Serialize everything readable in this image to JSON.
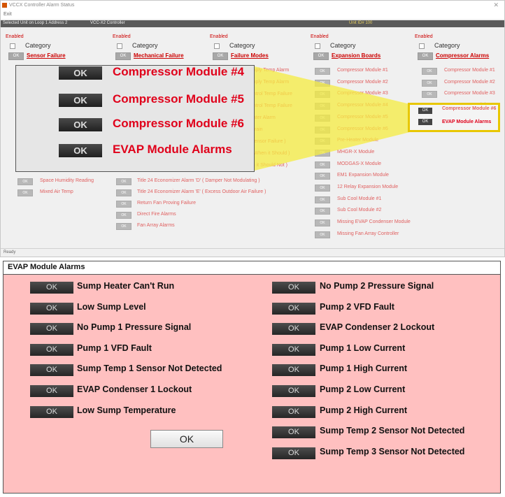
{
  "window": {
    "title": "VCCX Controller Alarm Status",
    "menu_exit": "Exit",
    "selected_unit": "Selected Unit on Loop 1 Address 2",
    "controller": "VCC-X2 Controller",
    "unit_id": "Unit ID# 100",
    "status": "Ready"
  },
  "headers": {
    "enabled": "Enabled",
    "category": "Category",
    "ok": "OK"
  },
  "categories": [
    {
      "name": "Sensor Failure"
    },
    {
      "name": "Mechanical Failure"
    },
    {
      "name": "Failure Modes"
    },
    {
      "name": "Expansion Boards"
    },
    {
      "name": "Compressor Alarms"
    }
  ],
  "col1_items": [
    "Space Humidity Reading",
    "Mixed Air Temp"
  ],
  "col2_items": [
    "Title 24 Economizer Alarm 'D'  ( Damper Not Modulating )",
    "Title 24 Economizer Alarm 'E'  ( Excess Outdoor Air Failure )",
    "Return Fan Proving Failure",
    "Direct Fire Alarms",
    "Fan Array Alarms"
  ],
  "col3_partial": [
    "Supply Temp Alarm",
    "Supply Temp Alarm",
    "Control Temp Failure",
    "Control Temp Failure",
    "Heater Alarm",
    "p Drain",
    "e Sensor Failure )",
    "ng When it Should )",
    "hen it Should Not )"
  ],
  "col4_items": [
    "Compressor Module #1",
    "Compressor Module #2",
    "Compressor Module #3",
    "Compressor Module #4",
    "Compressor Module #5",
    "Compressor Module #6",
    "Pre-Heater Module",
    "MHGR-X Module",
    "MODGAS-X Module",
    "EM1 Expansion Module",
    "12 Relay Expansion Module",
    "Sub Cool Module #1",
    "Sub Cool Module #2",
    "Missing EVAP Condenser Module",
    "Missing Fan Array Controller"
  ],
  "col5_items": [
    "Compressor Module #1",
    "Compressor Module #2",
    "Compressor Module #3",
    "Compressor Module #4",
    "Compressor Module #5",
    "Compressor Module #6",
    "EVAP Module Alarms"
  ],
  "zoom_items": [
    "Compressor Module #4",
    "Compressor Module #5",
    "Compressor Module #6",
    "EVAP Module Alarms"
  ],
  "panel": {
    "title": "EVAP Module Alarms",
    "left": [
      "Sump Heater Can't Run",
      "Low Sump Level",
      "No Pump 1 Pressure Signal",
      "Pump 1 VFD Fault",
      "Sump Temp 1 Sensor Not Detected",
      "EVAP Condenser 1 Lockout",
      "Low Sump Temperature"
    ],
    "right": [
      "No Pump 2 Pressure Signal",
      "Pump 2 VFD Fault",
      "EVAP Condenser 2 Lockout",
      "Pump 1 Low Current",
      "Pump 1 High Current",
      "Pump 2 Low Current",
      "Pump 2 High Current",
      "Sump Temp 2 Sensor Not Detected",
      "Sump Temp 3 Sensor Not Detected"
    ],
    "ok_button": "OK"
  },
  "colors": {
    "alarm_red": "#e0001a",
    "item_red": "#e06060",
    "panel_bg": "#ffc0c0",
    "highlight": "#e8c700"
  }
}
